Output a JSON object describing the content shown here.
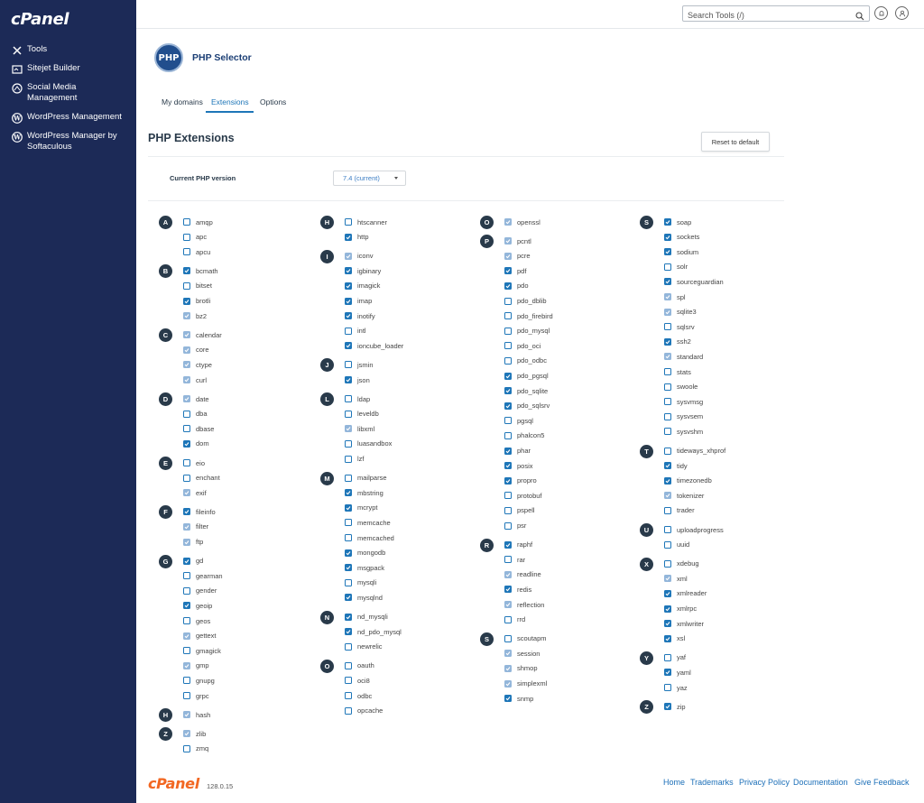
{
  "brand": {
    "logo_text": "cPanel",
    "version": "128.0.15"
  },
  "sidebar": {
    "items": [
      {
        "label": "Tools",
        "icon": "tools-icon"
      },
      {
        "label": "Sitejet Builder",
        "icon": "sitejet-icon"
      },
      {
        "label": "Social Media Management",
        "icon": "social-media-icon"
      },
      {
        "label": "WordPress Management",
        "icon": "wordpress-icon"
      },
      {
        "label": "WordPress Manager by Softaculous",
        "icon": "wordpress-icon"
      }
    ]
  },
  "header": {
    "search_placeholder": "Search Tools (/)",
    "icons": [
      "search-icon",
      "bell-icon",
      "user-icon"
    ]
  },
  "app": {
    "logo_text": "PHP",
    "title": "PHP Selector"
  },
  "tabs": [
    {
      "label": "My domains",
      "active": false
    },
    {
      "label": "Extensions",
      "active": true
    },
    {
      "label": "Options",
      "active": false
    }
  ],
  "section_title": "PHP Extensions",
  "reset_label": "Reset to default",
  "version": {
    "label": "Current PHP version",
    "value": "7.4 (current)"
  },
  "columns": [
    [
      {
        "letter": "A",
        "items": [
          [
            "amqp",
            "off"
          ],
          [
            "apc",
            "off"
          ],
          [
            "apcu",
            "off"
          ]
        ]
      },
      {
        "letter": "B",
        "items": [
          [
            "bcmath",
            "on"
          ],
          [
            "bitset",
            "off"
          ],
          [
            "brotli",
            "on"
          ],
          [
            "bz2",
            "dis"
          ]
        ]
      },
      {
        "letter": "C",
        "items": [
          [
            "calendar",
            "dis"
          ],
          [
            "core",
            "dis"
          ],
          [
            "ctype",
            "dis"
          ],
          [
            "curl",
            "dis"
          ]
        ]
      },
      {
        "letter": "D",
        "items": [
          [
            "date",
            "dis"
          ],
          [
            "dba",
            "off"
          ],
          [
            "dbase",
            "off"
          ],
          [
            "dom",
            "on"
          ]
        ]
      },
      {
        "letter": "E",
        "items": [
          [
            "eio",
            "off"
          ],
          [
            "enchant",
            "off"
          ],
          [
            "exif",
            "dis"
          ]
        ]
      },
      {
        "letter": "F",
        "items": [
          [
            "fileinfo",
            "on"
          ],
          [
            "filter",
            "dis"
          ],
          [
            "ftp",
            "dis"
          ]
        ]
      },
      {
        "letter": "G",
        "items": [
          [
            "gd",
            "on"
          ],
          [
            "gearman",
            "off"
          ],
          [
            "gender",
            "off"
          ],
          [
            "geoip",
            "on"
          ],
          [
            "geos",
            "off"
          ],
          [
            "gettext",
            "dis"
          ],
          [
            "gmagick",
            "off"
          ],
          [
            "gmp",
            "dis"
          ],
          [
            "gnupg",
            "off"
          ],
          [
            "grpc",
            "off"
          ]
        ]
      },
      {
        "letter": "H",
        "items": [
          [
            "hash",
            "dis"
          ]
        ]
      },
      {
        "letter": "Z",
        "items": [
          [
            "zlib",
            "dis"
          ],
          [
            "zmq",
            "off"
          ]
        ]
      }
    ],
    [
      {
        "letter": "H",
        "items": [
          [
            "htscanner",
            "off"
          ],
          [
            "http",
            "on"
          ]
        ]
      },
      {
        "letter": "I",
        "items": [
          [
            "iconv",
            "dis"
          ],
          [
            "igbinary",
            "on"
          ],
          [
            "imagick",
            "on"
          ],
          [
            "imap",
            "on"
          ],
          [
            "inotify",
            "on"
          ],
          [
            "intl",
            "off"
          ],
          [
            "ioncube_loader",
            "on"
          ]
        ]
      },
      {
        "letter": "J",
        "items": [
          [
            "jsmin",
            "off"
          ],
          [
            "json",
            "on"
          ]
        ]
      },
      {
        "letter": "L",
        "items": [
          [
            "ldap",
            "off"
          ],
          [
            "leveldb",
            "off"
          ],
          [
            "libxml",
            "dis"
          ],
          [
            "luasandbox",
            "off"
          ],
          [
            "lzf",
            "off"
          ]
        ]
      },
      {
        "letter": "M",
        "items": [
          [
            "mailparse",
            "off"
          ],
          [
            "mbstring",
            "on"
          ],
          [
            "mcrypt",
            "on"
          ],
          [
            "memcache",
            "off"
          ],
          [
            "memcached",
            "off"
          ],
          [
            "mongodb",
            "on"
          ],
          [
            "msgpack",
            "on"
          ],
          [
            "mysqli",
            "off"
          ],
          [
            "mysqlnd",
            "on"
          ]
        ]
      },
      {
        "letter": "N",
        "items": [
          [
            "nd_mysqli",
            "on"
          ],
          [
            "nd_pdo_mysql",
            "on"
          ],
          [
            "newrelic",
            "off"
          ]
        ]
      },
      {
        "letter": "O",
        "items": [
          [
            "oauth",
            "off"
          ],
          [
            "oci8",
            "off"
          ],
          [
            "odbc",
            "off"
          ],
          [
            "opcache",
            "off"
          ]
        ]
      }
    ],
    [
      {
        "letter": "O",
        "items": [
          [
            "openssl",
            "dis"
          ]
        ]
      },
      {
        "letter": "P",
        "items": [
          [
            "pcntl",
            "dis"
          ],
          [
            "pcre",
            "dis"
          ],
          [
            "pdf",
            "on"
          ],
          [
            "pdo",
            "on"
          ],
          [
            "pdo_dblib",
            "off"
          ],
          [
            "pdo_firebird",
            "off"
          ],
          [
            "pdo_mysql",
            "off"
          ],
          [
            "pdo_oci",
            "off"
          ],
          [
            "pdo_odbc",
            "off"
          ],
          [
            "pdo_pgsql",
            "on"
          ],
          [
            "pdo_sqlite",
            "on"
          ],
          [
            "pdo_sqlsrv",
            "on"
          ],
          [
            "pgsql",
            "off"
          ],
          [
            "phalcon5",
            "off"
          ],
          [
            "phar",
            "on"
          ],
          [
            "posix",
            "on"
          ],
          [
            "propro",
            "on"
          ],
          [
            "protobuf",
            "off"
          ],
          [
            "pspell",
            "off"
          ],
          [
            "psr",
            "off"
          ]
        ]
      },
      {
        "letter": "R",
        "items": [
          [
            "raphf",
            "on"
          ],
          [
            "rar",
            "off"
          ],
          [
            "readline",
            "dis"
          ],
          [
            "redis",
            "on"
          ],
          [
            "reflection",
            "dis"
          ],
          [
            "rrd",
            "off"
          ]
        ]
      },
      {
        "letter": "S",
        "items": [
          [
            "scoutapm",
            "off"
          ],
          [
            "session",
            "dis"
          ],
          [
            "shmop",
            "dis"
          ],
          [
            "simplexml",
            "dis"
          ],
          [
            "snmp",
            "on"
          ]
        ]
      }
    ],
    [
      {
        "letter": "S",
        "items": [
          [
            "soap",
            "on"
          ],
          [
            "sockets",
            "on"
          ],
          [
            "sodium",
            "on"
          ],
          [
            "solr",
            "off"
          ],
          [
            "sourceguardian",
            "on"
          ],
          [
            "spl",
            "dis"
          ],
          [
            "sqlite3",
            "dis"
          ],
          [
            "sqlsrv",
            "off"
          ],
          [
            "ssh2",
            "on"
          ],
          [
            "standard",
            "dis"
          ],
          [
            "stats",
            "off"
          ],
          [
            "swoole",
            "off"
          ],
          [
            "sysvmsg",
            "off"
          ],
          [
            "sysvsem",
            "off"
          ],
          [
            "sysvshm",
            "off"
          ]
        ]
      },
      {
        "letter": "T",
        "items": [
          [
            "tideways_xhprof",
            "off"
          ],
          [
            "tidy",
            "on"
          ],
          [
            "timezonedb",
            "on"
          ],
          [
            "tokenizer",
            "dis"
          ],
          [
            "trader",
            "off"
          ]
        ]
      },
      {
        "letter": "U",
        "items": [
          [
            "uploadprogress",
            "off"
          ],
          [
            "uuid",
            "off"
          ]
        ]
      },
      {
        "letter": "X",
        "items": [
          [
            "xdebug",
            "off"
          ],
          [
            "xml",
            "dis"
          ],
          [
            "xmlreader",
            "on"
          ],
          [
            "xmlrpc",
            "on"
          ],
          [
            "xmlwriter",
            "on"
          ],
          [
            "xsl",
            "on"
          ]
        ]
      },
      {
        "letter": "Y",
        "items": [
          [
            "yaf",
            "off"
          ],
          [
            "yaml",
            "on"
          ],
          [
            "yaz",
            "off"
          ]
        ]
      },
      {
        "letter": "Z",
        "items": [
          [
            "zip",
            "on"
          ]
        ]
      }
    ]
  ],
  "footer": {
    "links": [
      "Home",
      "Trademarks",
      "Privacy Policy",
      "Documentation",
      "Give Feedback"
    ]
  },
  "colors": {
    "sidebar": "#1c2a57",
    "accent": "#1e76b8",
    "disabled_check": "#93b6da",
    "footer_logo": "#f26722"
  }
}
